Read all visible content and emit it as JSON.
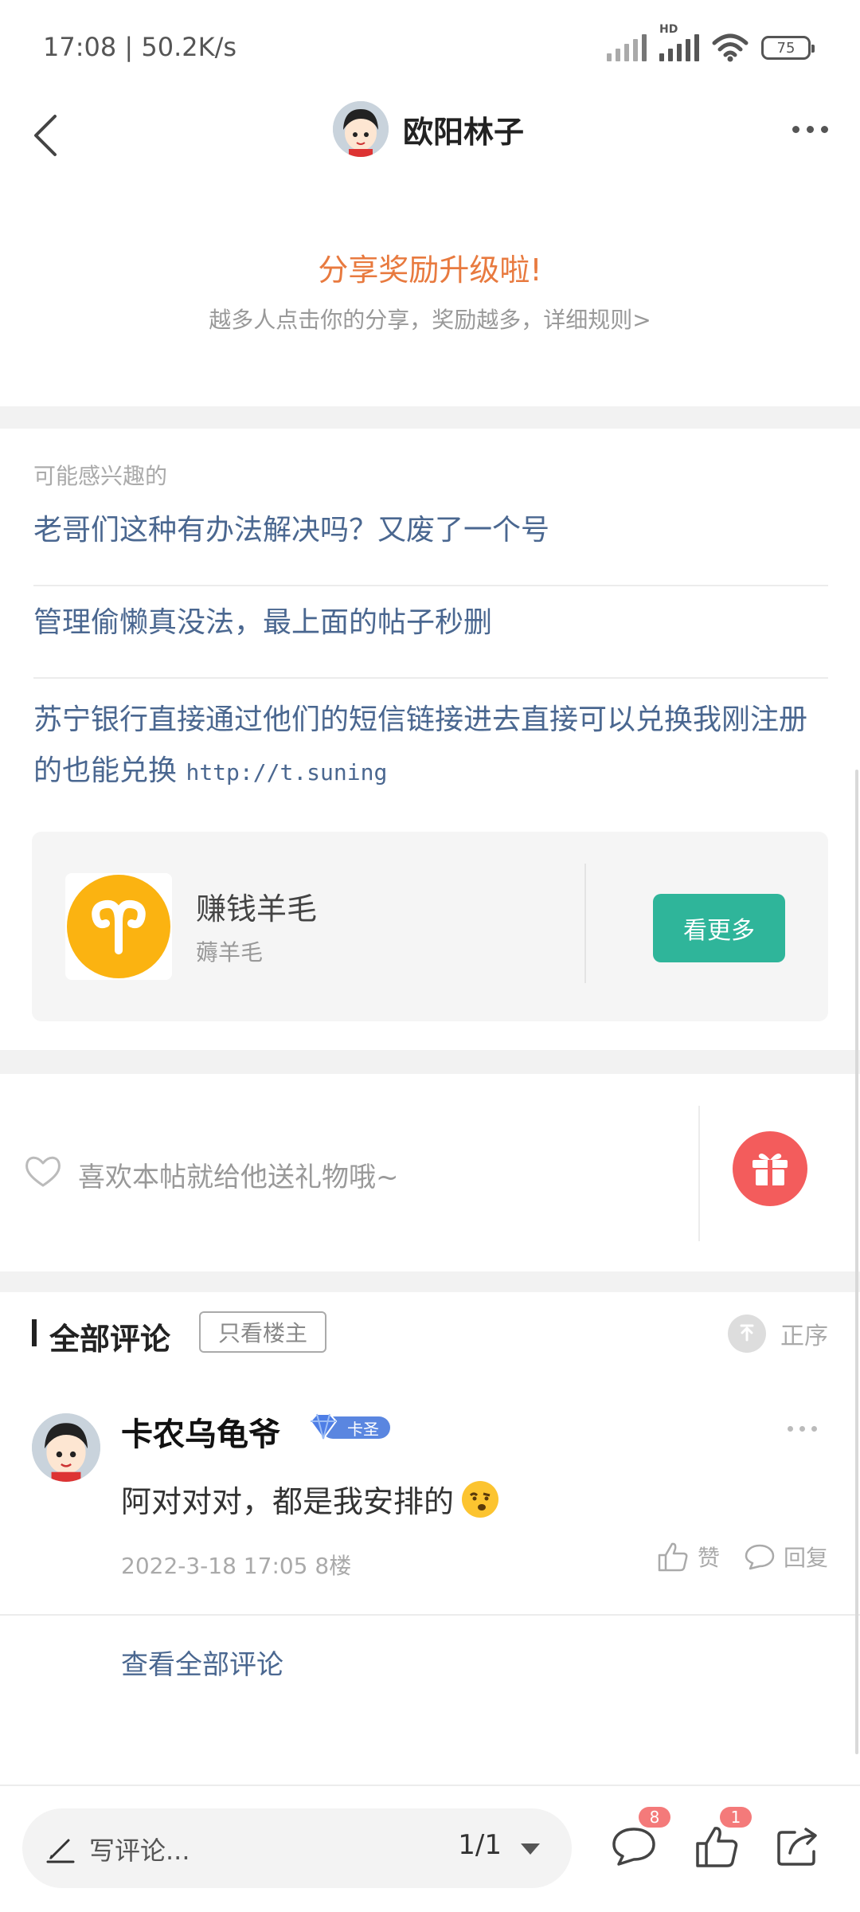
{
  "status_bar": {
    "time": "17:08 | 50.2K/s",
    "network_label": "HD",
    "battery": "75"
  },
  "nav": {
    "title": "欧阳林子"
  },
  "share": {
    "title": "分享奖励升级啦!",
    "subtitle": "越多人点击你的分享，奖励越多，详细规则>"
  },
  "interest": {
    "heading": "可能感兴趣的",
    "items": [
      {
        "text": "老哥们这种有办法解决吗？又废了一个号",
        "url": ""
      },
      {
        "text": "管理偷懒真没法，最上面的帖子秒删",
        "url": ""
      },
      {
        "text": "苏宁银行直接通过他们的短信链接进去直接可以兑换我刚注册的也能兑换",
        "url": "http://t.suning"
      }
    ],
    "topic": {
      "name": "赚钱羊毛",
      "desc": "薅羊毛",
      "button": "看更多"
    }
  },
  "gift": {
    "text": "喜欢本帖就给他送礼物哦~"
  },
  "comments": {
    "title": "全部评论",
    "only_op": "只看楼主",
    "sort_label": "正序",
    "items": [
      {
        "user": "卡农乌龟爷",
        "badge": "卡圣",
        "text": "阿对对对，都是我安排的",
        "meta": "2022-3-18 17:05  8楼",
        "like_label": "赞",
        "reply_label": "回复"
      }
    ],
    "view_all": "查看全部评论"
  },
  "bottom_bar": {
    "placeholder": "写评论...",
    "page": "1/1",
    "comment_count": "8",
    "like_count": "1"
  },
  "colors": {
    "accent_orange": "#e87a3f",
    "link_blue": "#4a6790",
    "topic_green": "#2fb59a",
    "gift_red": "#f35c5c",
    "badge_blue": "#5a86e0"
  }
}
